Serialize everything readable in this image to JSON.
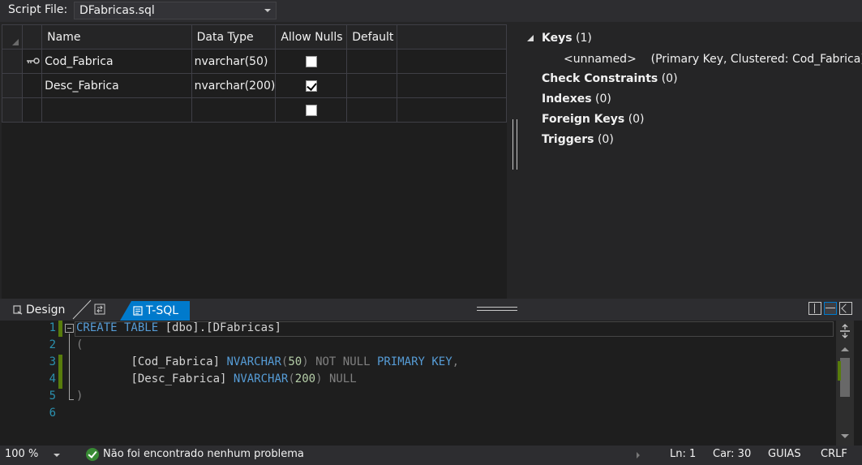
{
  "script_file": {
    "label": "Script File:",
    "value": "DFabricas.sql"
  },
  "grid": {
    "columns": [
      "Name",
      "Data Type",
      "Allow Nulls",
      "Default"
    ],
    "rows": [
      {
        "name": "Cod_Fabrica",
        "data_type": "nvarchar(50)",
        "allow_nulls": false,
        "default": "",
        "primary_key": true
      },
      {
        "name": "Desc_Fabrica",
        "data_type": "nvarchar(200)",
        "allow_nulls": true,
        "default": "",
        "primary_key": false
      },
      {
        "name": "",
        "data_type": "",
        "allow_nulls": false,
        "default": "",
        "primary_key": false
      }
    ]
  },
  "properties": {
    "keys": {
      "label": "Keys",
      "count": "(1)"
    },
    "key_entry": {
      "name": "<unnamed>",
      "detail": "(Primary Key, Clustered: Cod_Fabrica)"
    },
    "check_constraints": {
      "label": "Check Constraints",
      "count": "(0)"
    },
    "indexes": {
      "label": "Indexes",
      "count": "(0)"
    },
    "foreign_keys": {
      "label": "Foreign Keys",
      "count": "(0)"
    },
    "triggers": {
      "label": "Triggers",
      "count": "(0)"
    }
  },
  "tabs": {
    "design": "Design",
    "tsql": "T-SQL"
  },
  "editor": {
    "line_numbers": [
      "1",
      "2",
      "3",
      "4",
      "5",
      "6"
    ],
    "line1": {
      "kw1": "CREATE TABLE",
      "rest": " [dbo].[DFabricas]"
    },
    "line2": "(",
    "line3": {
      "indent": "        ",
      "col": "[Cod_Fabrica]",
      "type": "NVARCHAR",
      "open": "(",
      "num": "50",
      "close": ")",
      "null": "NOT NULL",
      "pk": "PRIMARY KEY",
      "comma": ","
    },
    "line4": {
      "indent": "        ",
      "col": "[Desc_Fabrica]",
      "type": "NVARCHAR",
      "open": "(",
      "num": "200",
      "close": ")",
      "null": "NULL"
    },
    "line5": ")"
  },
  "status": {
    "zoom": "100 %",
    "message": "Não foi encontrado nenhum problema",
    "line": "Ln: 1",
    "char": "Car: 30",
    "indent_mode": "GUIAS",
    "line_ending": "CRLF"
  },
  "colors": {
    "accent": "#007acc",
    "keyword": "#569cd6",
    "grey_keyword": "#808080",
    "line_number": "#2b91af",
    "number": "#b5cea8",
    "change_bar": "#587c0c",
    "ok": "#388a34"
  }
}
